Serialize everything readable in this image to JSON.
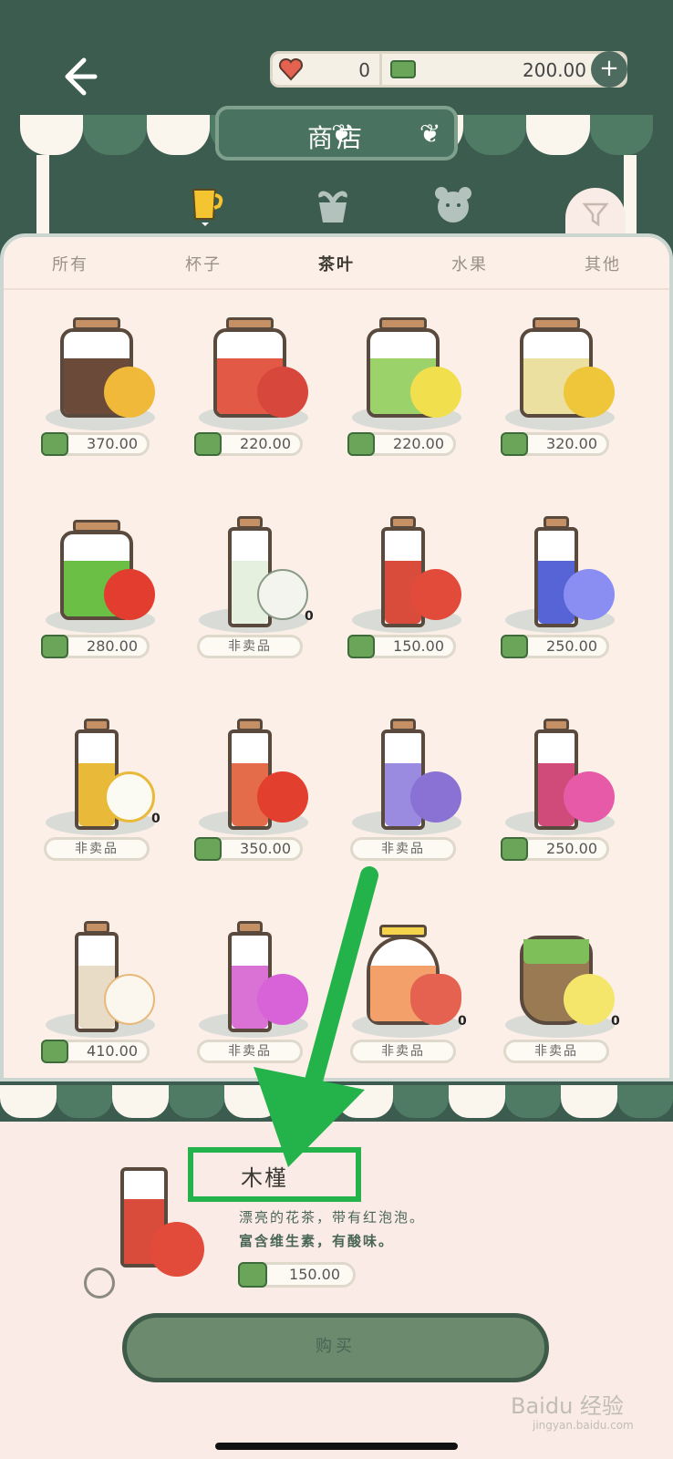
{
  "header": {
    "hearts": "0",
    "money": "200.00",
    "title": "商店",
    "plus_label": "+"
  },
  "subtabs": [
    "所有",
    "杯子",
    "茶叶",
    "水果",
    "其他"
  ],
  "active_subtab": 2,
  "items": [
    {
      "price": "370.00"
    },
    {
      "price": "220.00"
    },
    {
      "price": "220.00"
    },
    {
      "price": "320.00"
    },
    {
      "price": "280.00"
    },
    {
      "label": "非卖品",
      "zero": "0"
    },
    {
      "price": "150.00"
    },
    {
      "price": "250.00"
    },
    {
      "label": "非卖品",
      "zero": "0"
    },
    {
      "price": "350.00"
    },
    {
      "label": "非卖品"
    },
    {
      "price": "250.00"
    },
    {
      "price": "410.00"
    },
    {
      "label": "非卖品"
    },
    {
      "label": "非卖品",
      "zero": "0"
    },
    {
      "label": "非卖品",
      "zero": "0"
    }
  ],
  "detail": {
    "name": "木槿",
    "desc_line1": "漂亮的花茶，带有红泡泡。",
    "desc_line2": "富含维生素，有酸味。",
    "price": "150.00",
    "buy_label": "购买"
  },
  "watermark": {
    "brand": "Baidu 经验",
    "url": "jingyan.baidu.com"
  },
  "colors": {
    "header_bg": "#3d5c50",
    "panel_bg": "#fcefe8",
    "highlight": "#24b24a"
  }
}
